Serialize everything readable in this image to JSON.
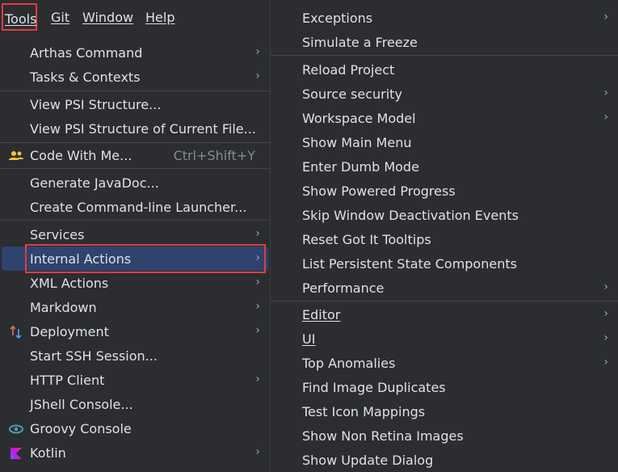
{
  "menubar": {
    "items": [
      {
        "label": "Tools"
      },
      {
        "label": "Git"
      },
      {
        "label": "Window"
      },
      {
        "label": "Help"
      }
    ]
  },
  "tools_menu": {
    "items": [
      {
        "label": "Arthas Command"
      },
      {
        "label": "Tasks & Contexts"
      },
      {
        "label": "View PSI Structure..."
      },
      {
        "label": "View PSI Structure of Current File..."
      },
      {
        "label": "Code With Me...",
        "shortcut": "Ctrl+Shift+Y",
        "icon": "users-icon"
      },
      {
        "label": "Generate JavaDoc..."
      },
      {
        "label": "Create Command-line Launcher..."
      },
      {
        "label": "Services"
      },
      {
        "label": "Internal Actions"
      },
      {
        "label": "XML Actions"
      },
      {
        "label": "Markdown"
      },
      {
        "label": "Deployment",
        "icon": "deployment-icon"
      },
      {
        "label": "Start SSH Session..."
      },
      {
        "label": "HTTP Client"
      },
      {
        "label": "JShell Console..."
      },
      {
        "label": "Groovy Console",
        "icon": "groovy-icon"
      },
      {
        "label": "Kotlin",
        "icon": "kotlin-icon"
      }
    ]
  },
  "internal_actions_menu": {
    "items": [
      {
        "label": "Exceptions"
      },
      {
        "label": "Simulate a Freeze"
      },
      {
        "label": "Reload Project"
      },
      {
        "label": "Source security"
      },
      {
        "label": "Workspace Model"
      },
      {
        "label": "Show Main Menu"
      },
      {
        "label": "Enter Dumb Mode"
      },
      {
        "label": "Show Powered Progress"
      },
      {
        "label": "Skip Window Deactivation Events"
      },
      {
        "label": "Reset Got It Tooltips"
      },
      {
        "label": "List Persistent State Components"
      },
      {
        "label": "Performance"
      },
      {
        "label": "Editor"
      },
      {
        "label": "UI"
      },
      {
        "label": "Top Anomalies"
      },
      {
        "label": "Find Image Duplicates"
      },
      {
        "label": "Test Icon Mappings"
      },
      {
        "label": "Show Non Retina Images"
      },
      {
        "label": "Show Update Dialog"
      }
    ]
  },
  "colors": {
    "menu_bg": "#2b2d30",
    "selection": "#2e436e",
    "highlight_border": "#e03d3d"
  }
}
